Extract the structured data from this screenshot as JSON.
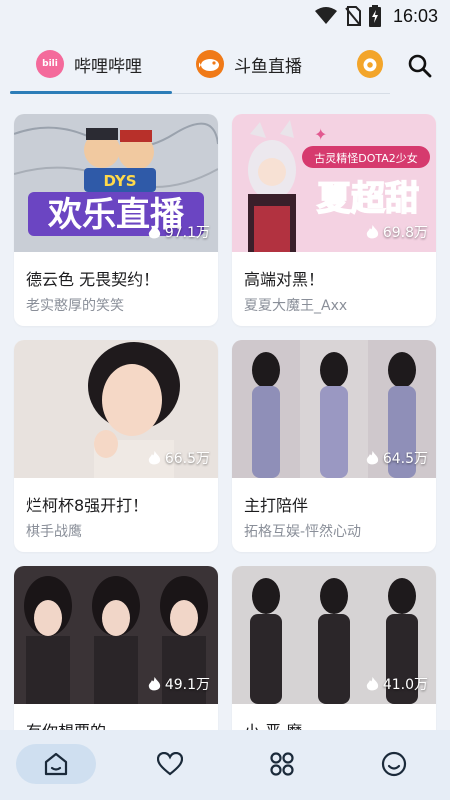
{
  "status_bar": {
    "time": "16:03",
    "icons": [
      "wifi-icon",
      "no-sim-icon",
      "battery-charging-icon"
    ]
  },
  "tabs": [
    {
      "label": "哔哩哔哩",
      "icon": "bilibili-logo",
      "logo_text": "bili",
      "active": true
    },
    {
      "label": "斗鱼直播",
      "icon": "douyu-logo",
      "active": false
    },
    {
      "label": "",
      "icon": "huya-logo",
      "active": false
    }
  ],
  "colors": {
    "accent": "#2c7db8",
    "background": "#eef2f8",
    "nav_active": "#cfdff0"
  },
  "rooms": [
    {
      "title": "德云色 无畏契约！",
      "streamer": "老实憨厚的笑笑",
      "viewers": "97.1万",
      "thumb_text": "欢乐直播",
      "thumb_badge": "DYS"
    },
    {
      "title": "高端对黑！",
      "streamer": "夏夏大魔王_Axx",
      "viewers": "69.8万",
      "thumb_text": "夏超甜",
      "thumb_badge": "古灵精怪DOTA2少女"
    },
    {
      "title": "烂柯杯8强开打！",
      "streamer": "棋手战鹰",
      "viewers": "66.5万"
    },
    {
      "title": "主打陪伴",
      "streamer": "拓格互娱-怦然心动",
      "viewers": "64.5万"
    },
    {
      "title": "有你想要的",
      "streamer": "",
      "viewers": "49.1万"
    },
    {
      "title": "小 恶 魔",
      "streamer": "",
      "viewers": "41.0万"
    }
  ],
  "bottom_nav": [
    {
      "name": "home",
      "icon": "home-icon",
      "active": true
    },
    {
      "name": "favorites",
      "icon": "heart-icon",
      "active": false
    },
    {
      "name": "categories",
      "icon": "grid-icon",
      "active": false
    },
    {
      "name": "profile",
      "icon": "smiley-icon",
      "active": false
    }
  ]
}
